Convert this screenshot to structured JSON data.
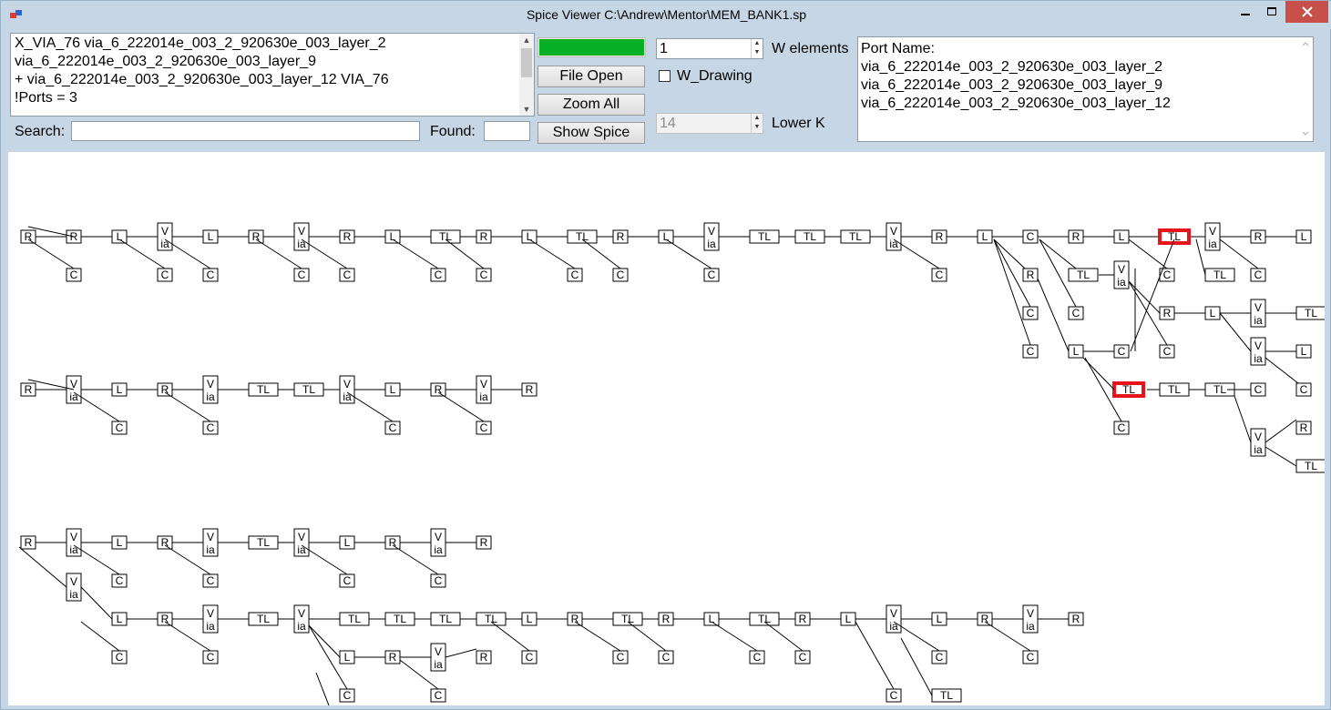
{
  "window": {
    "title": "Spice Viewer  C:\\Andrew\\Mentor\\MEM_BANK1.sp"
  },
  "cmd_lines": [
    "X_VIA_76 via_6_222014e_003_2_920630e_003_layer_2",
    "via_6_222014e_003_2_920630e_003_layer_9",
    "+ via_6_222014e_003_2_920630e_003_layer_12 VIA_76",
    "!Ports = 3"
  ],
  "search": {
    "label": "Search:",
    "value": ""
  },
  "found": {
    "label": "Found:",
    "value": ""
  },
  "progress": {
    "fraction": 1.0,
    "color": "#06b025"
  },
  "buttons": {
    "file_open": "File Open",
    "zoom_all": "Zoom All",
    "show_spice": "Show Spice"
  },
  "w_elements": {
    "value": "1",
    "label": "W elements"
  },
  "lower_k": {
    "value": "14",
    "label": "Lower K"
  },
  "w_drawing": {
    "label": "W_Drawing",
    "checked": false
  },
  "ports": {
    "header": "Port Name:",
    "names": [
      "via_6_222014e_003_2_920630e_003_layer_2",
      "via_6_222014e_003_2_920630e_003_layer_9",
      "via_6_222014e_003_2_920630e_003_layer_12"
    ]
  },
  "element_labels": {
    "R": "R",
    "L": "L",
    "C": "C",
    "TL": "TL",
    "via_top": "V",
    "via_bottom": "ia"
  },
  "colors": {
    "highlight": "#e8141b",
    "background": "#c7d6e4"
  }
}
